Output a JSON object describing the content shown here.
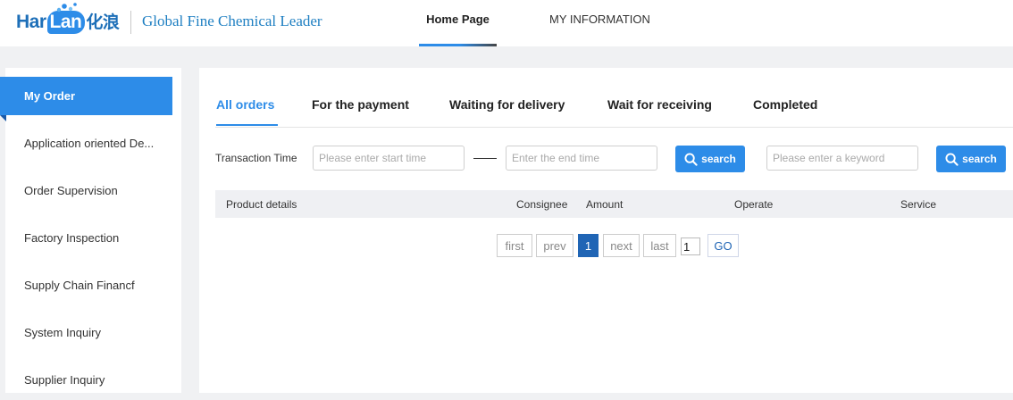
{
  "header": {
    "logo": {
      "har": "Har",
      "lan": "Lan",
      "cn": "化浪"
    },
    "tagline": "Global Fine Chemical Leader",
    "nav": {
      "home": "Home Page",
      "info": "MY INFORMATION"
    }
  },
  "sidebar": {
    "active": "My Order",
    "items": [
      {
        "label": "Application oriented De..."
      },
      {
        "label": "Order Supervision"
      },
      {
        "label": "Factory Inspection"
      },
      {
        "label": "Supply Chain Financf"
      },
      {
        "label": "System Inquiry"
      },
      {
        "label": "Supplier Inquiry"
      }
    ]
  },
  "tabs": [
    "All orders",
    "For the payment",
    "Waiting for delivery",
    "Wait for receiving",
    "Completed"
  ],
  "filters": {
    "transaction_label": "Transaction Time",
    "start_placeholder": "Please enter start time",
    "end_placeholder": "Enter the end time",
    "keyword_placeholder": "Please enter a keyword",
    "search_label": "search"
  },
  "table": {
    "headers": [
      "Product details",
      "Consignee",
      "Amount",
      "Operate",
      "Service"
    ]
  },
  "pagination": {
    "first": "first",
    "prev": "prev",
    "current": "1",
    "next": "next",
    "last": "last",
    "page_value": "1",
    "go": "GO"
  },
  "colors": {
    "accent": "#2d8ce8",
    "pager_active": "#2065b5"
  }
}
